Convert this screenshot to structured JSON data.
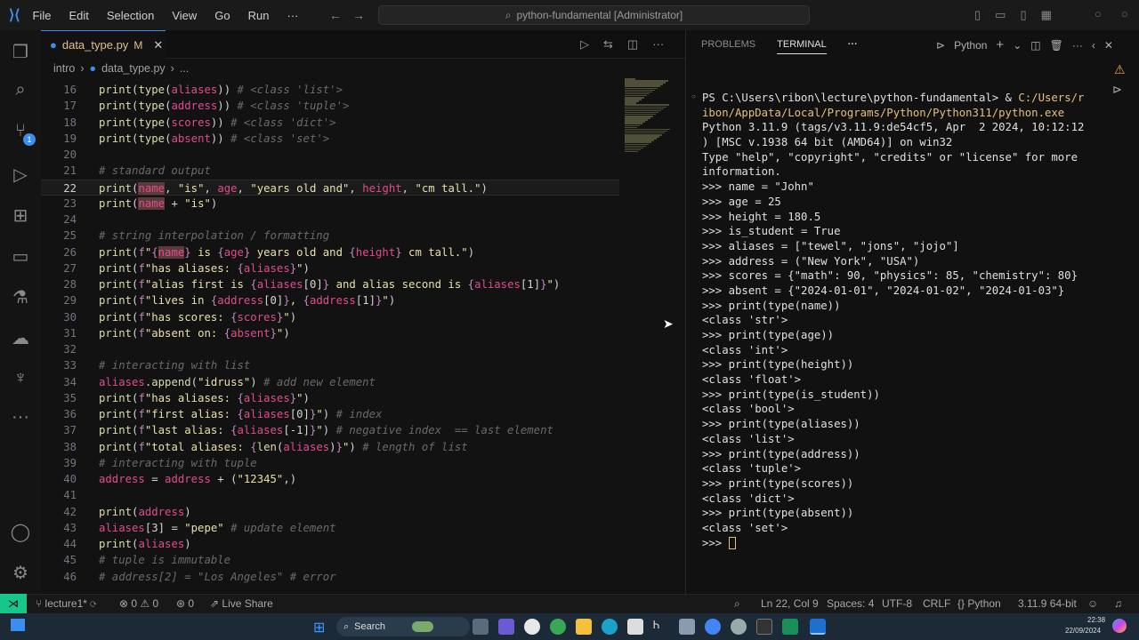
{
  "titlebar": {
    "menu": [
      "File",
      "Edit",
      "Selection",
      "View",
      "Go",
      "Run",
      "···"
    ],
    "search": "python-fundamental [Administrator]"
  },
  "activity": {
    "source_control_badge": "1"
  },
  "tab": {
    "filename": "data_type.py",
    "status": "M"
  },
  "breadcrumb": {
    "folder": "intro",
    "file": "data_type.py",
    "rest": "..."
  },
  "panel": {
    "tabs": [
      "PROBLEMS",
      "TERMINAL",
      "···"
    ],
    "shell": "Python"
  },
  "code_lines": [
    {
      "n": "16",
      "t": [
        [
          "k",
          "print"
        ],
        [
          "w",
          "("
        ],
        [
          "k",
          "type"
        ],
        [
          "w",
          "("
        ],
        [
          "v",
          "aliases"
        ],
        [
          "w",
          "))"
        ],
        [
          "c",
          " # <class 'list'>"
        ]
      ]
    },
    {
      "n": "17",
      "t": [
        [
          "k",
          "print"
        ],
        [
          "w",
          "("
        ],
        [
          "k",
          "type"
        ],
        [
          "w",
          "("
        ],
        [
          "v",
          "address"
        ],
        [
          "w",
          "))"
        ],
        [
          "c",
          " # <class 'tuple'>"
        ]
      ]
    },
    {
      "n": "18",
      "t": [
        [
          "k",
          "print"
        ],
        [
          "w",
          "("
        ],
        [
          "k",
          "type"
        ],
        [
          "w",
          "("
        ],
        [
          "v",
          "scores"
        ],
        [
          "w",
          "))"
        ],
        [
          "c",
          " # <class 'dict'>"
        ]
      ]
    },
    {
      "n": "19",
      "t": [
        [
          "k",
          "print"
        ],
        [
          "w",
          "("
        ],
        [
          "k",
          "type"
        ],
        [
          "w",
          "("
        ],
        [
          "v",
          "absent"
        ],
        [
          "w",
          "))"
        ],
        [
          "c",
          " # <class 'set'>"
        ]
      ]
    },
    {
      "n": "20",
      "t": []
    },
    {
      "n": "21",
      "t": [
        [
          "c",
          "# standard output"
        ]
      ]
    },
    {
      "n": "22",
      "t": [
        [
          "k",
          "print"
        ],
        [
          "w",
          "("
        ],
        [
          "v",
          "name"
        ],
        [
          "w",
          ", "
        ],
        [
          "s",
          "\"is\""
        ],
        [
          "w",
          ", "
        ],
        [
          "v",
          "age"
        ],
        [
          "w",
          ", "
        ],
        [
          "s",
          "\"years old and\""
        ],
        [
          "w",
          ", "
        ],
        [
          "v",
          "height"
        ],
        [
          "w",
          ", "
        ],
        [
          "s",
          "\"cm tall.\""
        ],
        [
          "w",
          ")"
        ]
      ]
    },
    {
      "n": "23",
      "t": [
        [
          "k",
          "print"
        ],
        [
          "w",
          "("
        ],
        [
          "v",
          "name"
        ],
        [
          "w",
          " + "
        ],
        [
          "s",
          "\"is\""
        ],
        [
          "w",
          ")"
        ]
      ]
    },
    {
      "n": "24",
      "t": []
    },
    {
      "n": "25",
      "t": [
        [
          "c",
          "# string interpolation / formatting"
        ]
      ]
    },
    {
      "n": "26",
      "t": [
        [
          "k",
          "print"
        ],
        [
          "w",
          "("
        ],
        [
          "b",
          "f"
        ],
        [
          "s",
          "\""
        ],
        [
          "b",
          "{"
        ],
        [
          "v",
          "name"
        ],
        [
          "b",
          "}"
        ],
        [
          "s",
          " is "
        ],
        [
          "b",
          "{"
        ],
        [
          "v",
          "age"
        ],
        [
          "b",
          "}"
        ],
        [
          "s",
          " years old and "
        ],
        [
          "b",
          "{"
        ],
        [
          "v",
          "height"
        ],
        [
          "b",
          "}"
        ],
        [
          "s",
          " cm tall.\""
        ],
        [
          "w",
          ")"
        ]
      ]
    },
    {
      "n": "27",
      "t": [
        [
          "k",
          "print"
        ],
        [
          "w",
          "("
        ],
        [
          "b",
          "f"
        ],
        [
          "s",
          "\"has aliases: "
        ],
        [
          "b",
          "{"
        ],
        [
          "v",
          "aliases"
        ],
        [
          "b",
          "}"
        ],
        [
          "s",
          "\""
        ],
        [
          "w",
          ")"
        ]
      ]
    },
    {
      "n": "28",
      "t": [
        [
          "k",
          "print"
        ],
        [
          "w",
          "("
        ],
        [
          "b",
          "f"
        ],
        [
          "s",
          "\"alias first is "
        ],
        [
          "b",
          "{"
        ],
        [
          "v",
          "aliases"
        ],
        [
          "w",
          "[0]"
        ],
        [
          "b",
          "}"
        ],
        [
          "s",
          " and alias second is "
        ],
        [
          "b",
          "{"
        ],
        [
          "v",
          "aliases"
        ],
        [
          "w",
          "[1]"
        ],
        [
          "b",
          "}"
        ],
        [
          "s",
          "\""
        ],
        [
          "w",
          ")"
        ]
      ]
    },
    {
      "n": "29",
      "t": [
        [
          "k",
          "print"
        ],
        [
          "w",
          "("
        ],
        [
          "b",
          "f"
        ],
        [
          "s",
          "\"lives in "
        ],
        [
          "b",
          "{"
        ],
        [
          "v",
          "address"
        ],
        [
          "w",
          "[0]"
        ],
        [
          "b",
          "}"
        ],
        [
          "s",
          ", "
        ],
        [
          "b",
          "{"
        ],
        [
          "v",
          "address"
        ],
        [
          "w",
          "[1]"
        ],
        [
          "b",
          "}"
        ],
        [
          "s",
          "\""
        ],
        [
          "w",
          ")"
        ]
      ]
    },
    {
      "n": "30",
      "t": [
        [
          "k",
          "print"
        ],
        [
          "w",
          "("
        ],
        [
          "b",
          "f"
        ],
        [
          "s",
          "\"has scores: "
        ],
        [
          "b",
          "{"
        ],
        [
          "v",
          "scores"
        ],
        [
          "b",
          "}"
        ],
        [
          "s",
          "\""
        ],
        [
          "w",
          ")"
        ]
      ]
    },
    {
      "n": "31",
      "t": [
        [
          "k",
          "print"
        ],
        [
          "w",
          "("
        ],
        [
          "b",
          "f"
        ],
        [
          "s",
          "\"absent on: "
        ],
        [
          "b",
          "{"
        ],
        [
          "v",
          "absent"
        ],
        [
          "b",
          "}"
        ],
        [
          "s",
          "\""
        ],
        [
          "w",
          ")"
        ]
      ]
    },
    {
      "n": "32",
      "t": []
    },
    {
      "n": "33",
      "t": [
        [
          "c",
          "# interacting with list"
        ]
      ]
    },
    {
      "n": "34",
      "t": [
        [
          "v",
          "aliases"
        ],
        [
          "w",
          "."
        ],
        [
          "k",
          "append"
        ],
        [
          "w",
          "("
        ],
        [
          "s",
          "\"idruss\""
        ],
        [
          "w",
          ")"
        ],
        [
          "c",
          " # add new element"
        ]
      ]
    },
    {
      "n": "35",
      "t": [
        [
          "k",
          "print"
        ],
        [
          "w",
          "("
        ],
        [
          "b",
          "f"
        ],
        [
          "s",
          "\"has aliases: "
        ],
        [
          "b",
          "{"
        ],
        [
          "v",
          "aliases"
        ],
        [
          "b",
          "}"
        ],
        [
          "s",
          "\""
        ],
        [
          "w",
          ")"
        ]
      ]
    },
    {
      "n": "36",
      "t": [
        [
          "k",
          "print"
        ],
        [
          "w",
          "("
        ],
        [
          "b",
          "f"
        ],
        [
          "s",
          "\"first alias: "
        ],
        [
          "b",
          "{"
        ],
        [
          "v",
          "aliases"
        ],
        [
          "w",
          "[0]"
        ],
        [
          "b",
          "}"
        ],
        [
          "s",
          "\""
        ],
        [
          "w",
          ")"
        ],
        [
          "c",
          " # index"
        ]
      ]
    },
    {
      "n": "37",
      "t": [
        [
          "k",
          "print"
        ],
        [
          "w",
          "("
        ],
        [
          "b",
          "f"
        ],
        [
          "s",
          "\"last alias: "
        ],
        [
          "b",
          "{"
        ],
        [
          "v",
          "aliases"
        ],
        [
          "w",
          "[-1]"
        ],
        [
          "b",
          "}"
        ],
        [
          "s",
          "\""
        ],
        [
          "w",
          ")"
        ],
        [
          "c",
          " # negative index  == last element"
        ]
      ]
    },
    {
      "n": "38",
      "t": [
        [
          "k",
          "print"
        ],
        [
          "w",
          "("
        ],
        [
          "b",
          "f"
        ],
        [
          "s",
          "\"total aliases: "
        ],
        [
          "b",
          "{"
        ],
        [
          "k",
          "len"
        ],
        [
          "w",
          "("
        ],
        [
          "v",
          "aliases"
        ],
        [
          "w",
          ")"
        ],
        [
          "b",
          "}"
        ],
        [
          "s",
          "\""
        ],
        [
          "w",
          ")"
        ],
        [
          "c",
          " # length of list"
        ]
      ]
    },
    {
      "n": "39",
      "t": [
        [
          "c",
          "# interacting with tuple"
        ]
      ]
    },
    {
      "n": "40",
      "t": [
        [
          "v",
          "address"
        ],
        [
          "w",
          " = "
        ],
        [
          "v",
          "address"
        ],
        [
          "w",
          " + ("
        ],
        [
          "s",
          "\"12345\""
        ],
        [
          "w",
          ",)"
        ]
      ]
    },
    {
      "n": "41",
      "t": []
    },
    {
      "n": "42",
      "t": [
        [
          "k",
          "print"
        ],
        [
          "w",
          "("
        ],
        [
          "v",
          "address"
        ],
        [
          "w",
          ")"
        ]
      ]
    },
    {
      "n": "43",
      "t": [
        [
          "v",
          "aliases"
        ],
        [
          "w",
          "[3] = "
        ],
        [
          "s",
          "\"pepe\""
        ],
        [
          "c",
          " # update element"
        ]
      ]
    },
    {
      "n": "44",
      "t": [
        [
          "k",
          "print"
        ],
        [
          "w",
          "("
        ],
        [
          "v",
          "aliases"
        ],
        [
          "w",
          ")"
        ]
      ]
    },
    {
      "n": "45",
      "t": [
        [
          "c",
          "# tuple is immutable"
        ]
      ]
    },
    {
      "n": "46",
      "t": [
        [
          "c",
          "# address[2] = \"Los Angeles\" # error"
        ]
      ]
    }
  ],
  "terminal": [
    [
      [
        "w",
        "PS C:\\Users\\ribon\\lecture\\python-fundamental> & "
      ],
      [
        "path",
        "C:/Users/r"
      ]
    ],
    [
      [
        "path",
        "ibon/AppData/Local/Programs/Python/Python311/python.exe"
      ]
    ],
    [
      [
        "w",
        "Python 3.11.9 (tags/v3.11.9:de54cf5, Apr  2 2024, 10:12:12"
      ]
    ],
    [
      [
        "w",
        ") [MSC v.1938 64 bit (AMD64)] on win32"
      ]
    ],
    [
      [
        "w",
        "Type \"help\", \"copyright\", \"credits\" or \"license\" for more"
      ]
    ],
    [
      [
        "w",
        "information."
      ]
    ],
    [
      [
        "w",
        ">>> name = \"John\""
      ]
    ],
    [
      [
        "w",
        ">>> age = 25"
      ]
    ],
    [
      [
        "w",
        ">>> height = 180.5"
      ]
    ],
    [
      [
        "w",
        ">>> is_student = True"
      ]
    ],
    [
      [
        "w",
        ">>> aliases = [\"tewel\", \"jons\", \"jojo\"]"
      ]
    ],
    [
      [
        "w",
        ">>> address = (\"New York\", \"USA\")"
      ]
    ],
    [
      [
        "w",
        ">>> scores = {\"math\": 90, \"physics\": 85, \"chemistry\": 80}"
      ]
    ],
    [
      [
        "w",
        ">>> absent = {\"2024-01-01\", \"2024-01-02\", \"2024-01-03\"}"
      ]
    ],
    [
      [
        "w",
        ">>> print(type(name))"
      ]
    ],
    [
      [
        "w",
        "<class 'str'>"
      ]
    ],
    [
      [
        "w",
        ">>> print(type(age))"
      ]
    ],
    [
      [
        "w",
        "<class 'int'>"
      ]
    ],
    [
      [
        "w",
        ">>> print(type(height))"
      ]
    ],
    [
      [
        "w",
        "<class 'float'>"
      ]
    ],
    [
      [
        "w",
        ">>> print(type(is_student))"
      ]
    ],
    [
      [
        "w",
        "<class 'bool'>"
      ]
    ],
    [
      [
        "w",
        ">>> print(type(aliases))"
      ]
    ],
    [
      [
        "w",
        "<class 'list'>"
      ]
    ],
    [
      [
        "w",
        ">>> print(type(address))"
      ]
    ],
    [
      [
        "w",
        "<class 'tuple'>"
      ]
    ],
    [
      [
        "w",
        ">>> print(type(scores))"
      ]
    ],
    [
      [
        "w",
        "<class 'dict'>"
      ]
    ],
    [
      [
        "w",
        ">>> print(type(absent))"
      ]
    ],
    [
      [
        "w",
        "<class 'set'>"
      ]
    ],
    [
      [
        "w",
        ">>> "
      ]
    ]
  ],
  "status": {
    "branch": "lecture1*",
    "errors": "0",
    "warnings": "0",
    "ports": "0",
    "liveshare": "Live Share",
    "position": "Ln 22, Col 9",
    "spaces": "Spaces: 4",
    "encoding": "UTF-8",
    "eol": "CRLF",
    "language": "Python",
    "interpreter": "3.11.9 64-bit"
  },
  "taskbar": {
    "search": "Search",
    "time": "22:38",
    "date": "22/09/2024"
  },
  "colors": {
    "accent": "#3b8eea",
    "remote": "#16c68b"
  }
}
